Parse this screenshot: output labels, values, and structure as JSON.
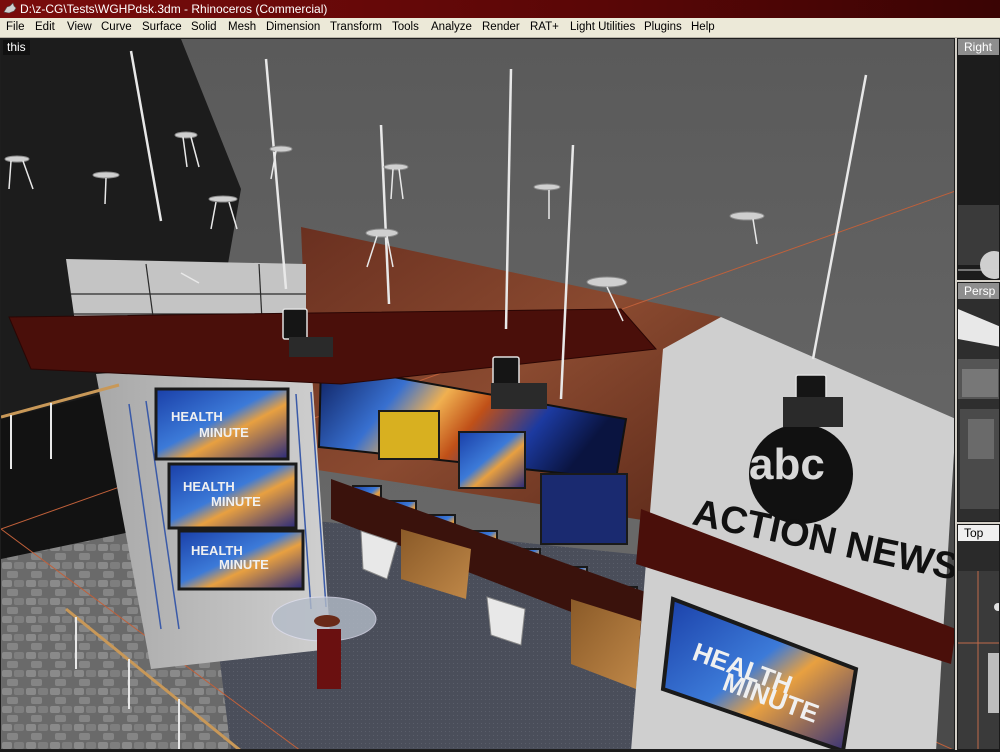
{
  "window": {
    "title": "D:\\z-CG\\Tests\\WGHPdsk.3dm - Rhinoceros (Commercial)",
    "app_icon": "rhino-icon"
  },
  "menu": [
    "File",
    "Edit",
    "View",
    "Curve",
    "Surface",
    "Solid",
    "Mesh",
    "Dimension",
    "Transform",
    "Tools",
    "Analyze",
    "Render",
    "RAT+",
    "Light Utilities",
    "Plugins",
    "Help"
  ],
  "viewports": {
    "main_label": "this",
    "right_label": "Right",
    "perspective_label": "Persp",
    "top_label": "Top"
  },
  "scene": {
    "sign_text": "ACTION NEWS",
    "logo_text": "abc",
    "monitor_title_line1": "HEALTH",
    "monitor_title_line2": "MINUTE"
  },
  "colors": {
    "title_bar": "#6a0a0a",
    "viewport_bg": "#3a3a3a",
    "wall_grey": "#6b6b6b",
    "beam_maroon": "#4a0f0a"
  }
}
